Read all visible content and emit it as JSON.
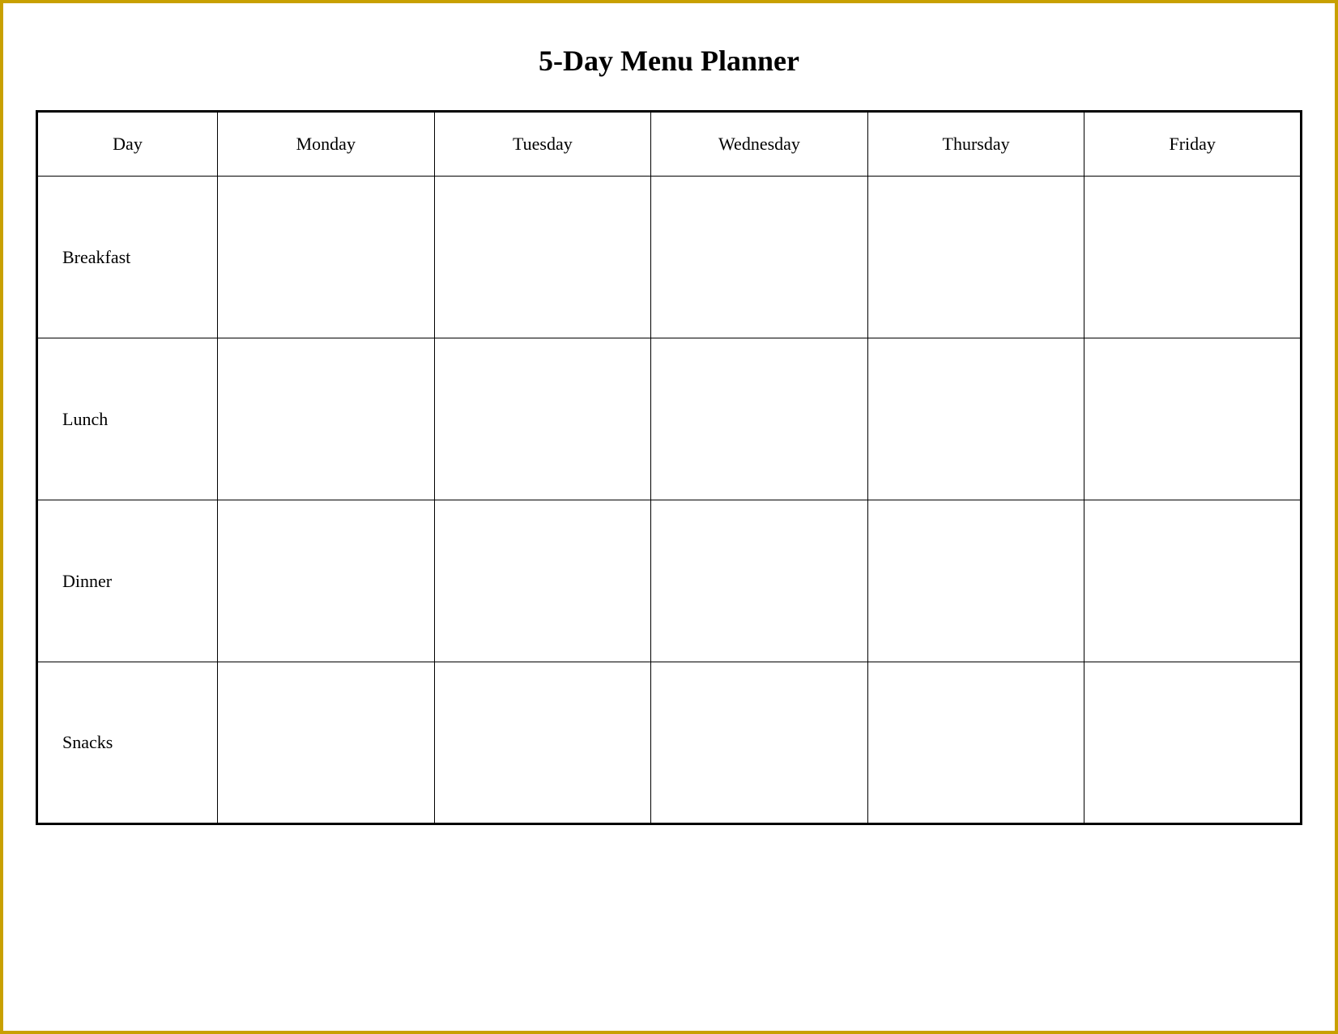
{
  "title": "5-Day Menu Planner",
  "table": {
    "headers": [
      "Day",
      "Monday",
      "Tuesday",
      "Wednesday",
      "Thursday",
      "Friday"
    ],
    "rows": [
      {
        "label": "Breakfast"
      },
      {
        "label": "Lunch"
      },
      {
        "label": "Dinner"
      },
      {
        "label": "Snacks"
      }
    ]
  }
}
